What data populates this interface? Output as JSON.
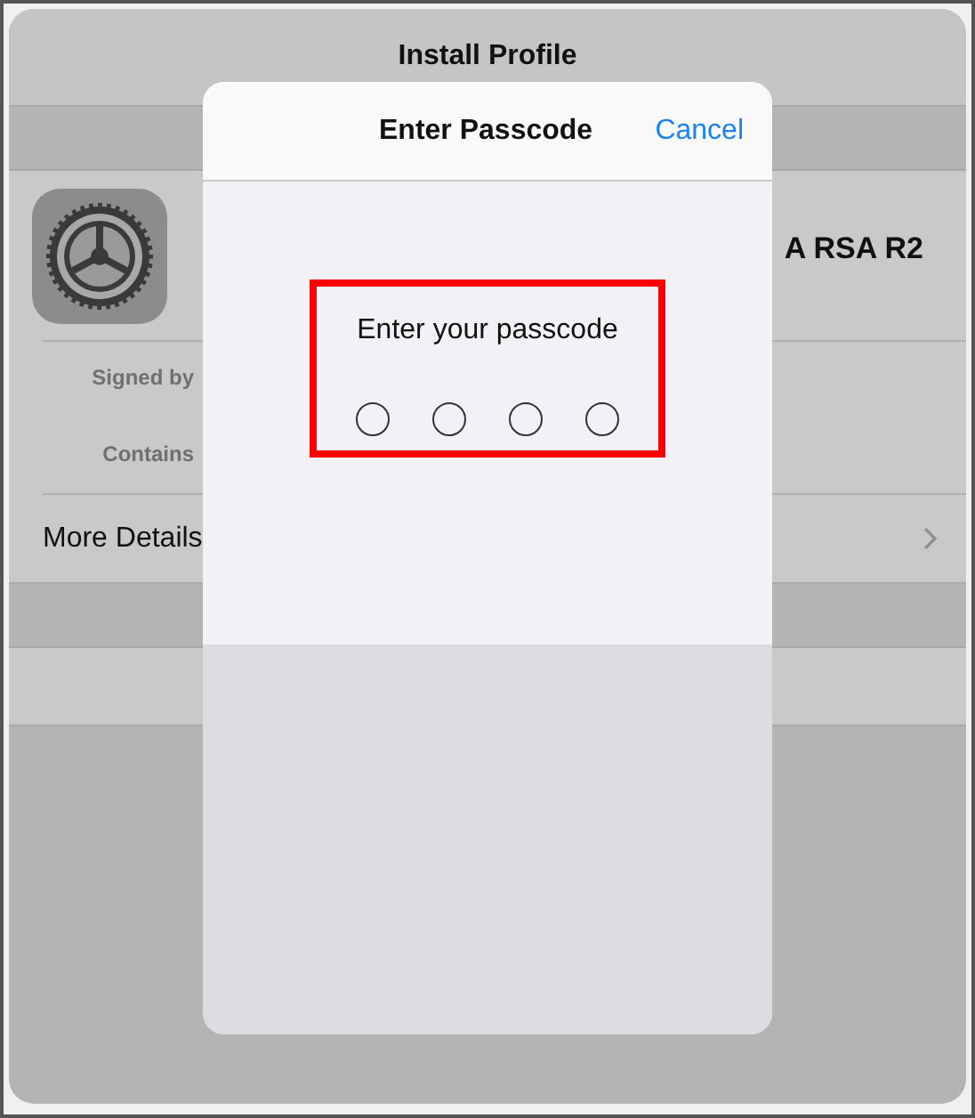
{
  "screen": {
    "title": "Install Profile"
  },
  "profile": {
    "name_end": "A RSA R2",
    "signed_by_label": "Signed by",
    "contains_label": "Contains",
    "more_details": "More Details"
  },
  "dialog": {
    "title": "Enter Passcode",
    "cancel": "Cancel",
    "prompt": "Enter your passcode",
    "digits": [
      {
        "filled": false
      },
      {
        "filled": false
      },
      {
        "filled": false
      },
      {
        "filled": false
      }
    ]
  }
}
